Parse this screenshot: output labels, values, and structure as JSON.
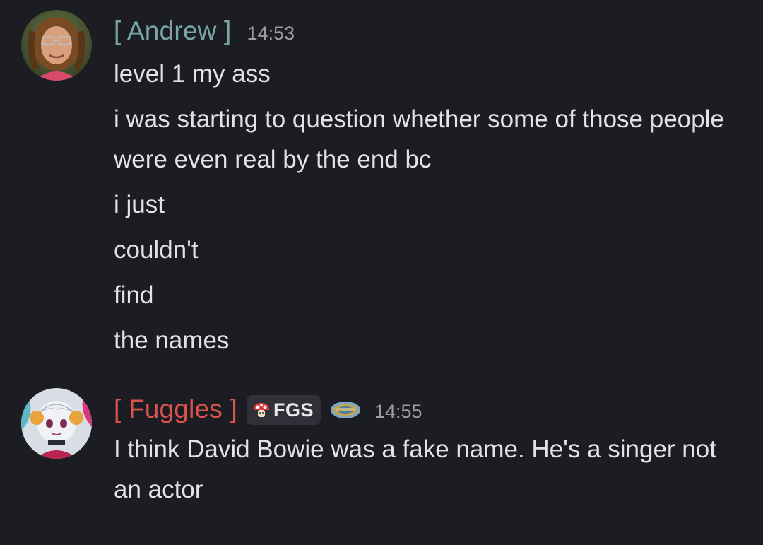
{
  "messages": [
    {
      "username": "[ Andrew ]",
      "timestamp": "14:53",
      "avatar_icon": "andrew-avatar-photo",
      "username_color": "#7aa6a6",
      "lines": [
        "level 1 my ass",
        "i was starting to question whether some of those people were even real by the end bc",
        "i just",
        "couldn't",
        "find",
        "the names"
      ]
    },
    {
      "username": "[ Fuggles ]",
      "timestamp": "14:55",
      "avatar_icon": "fuggles-avatar-anime",
      "username_color": "#d9534f",
      "tag": {
        "icon": "mushroom-icon",
        "text": "FGS"
      },
      "badge_icon": "server-badge-icon",
      "lines": [
        "I think David Bowie was a fake name. He's a singer not an actor"
      ]
    }
  ],
  "colors": {
    "background": "#1c1d22",
    "text": "#e2e3e8",
    "timestamp": "#9a9ca4",
    "tag_background": "#2f3038"
  }
}
